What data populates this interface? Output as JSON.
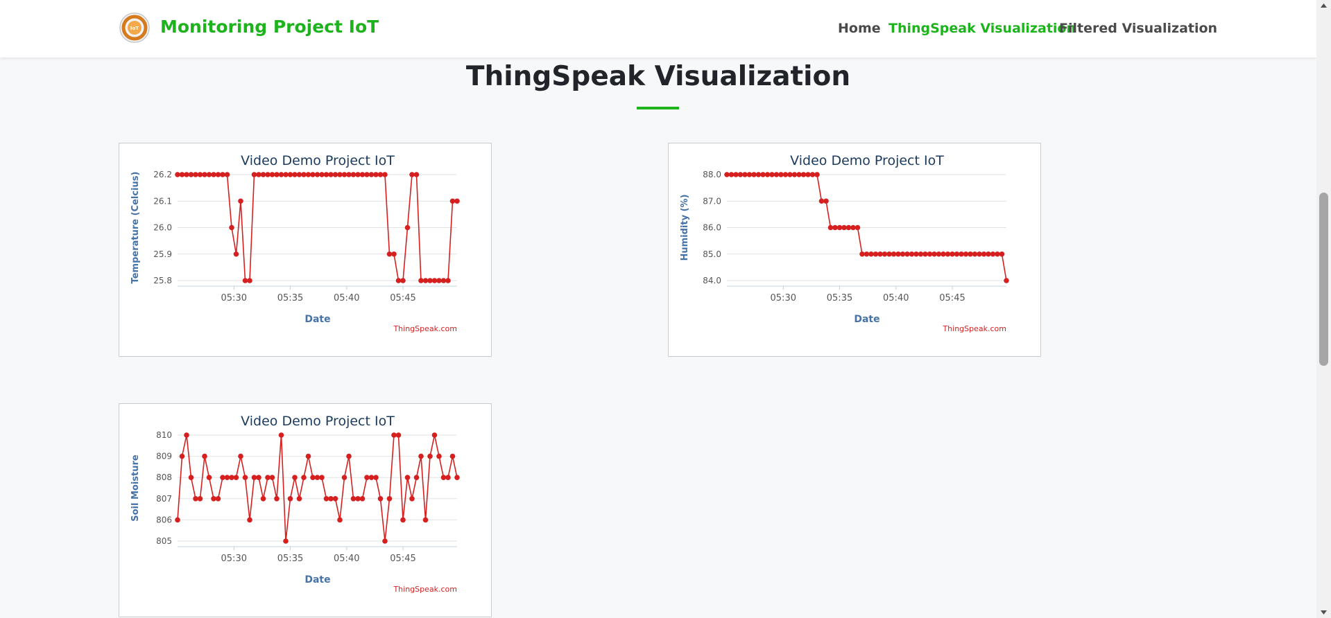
{
  "navbar": {
    "brand": "Monitoring Project IoT",
    "logo_text": "IoT",
    "links": [
      {
        "label": "Home",
        "active": false
      },
      {
        "label": "ThingSpeak Visualization",
        "active": true
      },
      {
        "label": "Filtered Visualization",
        "active": false
      }
    ]
  },
  "page": {
    "title": "ThingSpeak Visualization"
  },
  "colors": {
    "accent": "#1cb31c",
    "series": "#d62020",
    "chart_title": "#1b3a5c",
    "axis_label": "#4572a7"
  },
  "chart_data": [
    {
      "type": "line",
      "title": "Video Demo Project IoT",
      "xlabel": "Date",
      "ylabel": "Temperature (Celcius)",
      "credit": "ThingSpeak.com",
      "ylim": [
        25.8,
        26.2
      ],
      "yticks": [
        "26.2",
        "26.1",
        "26.0",
        "25.9",
        "25.8"
      ],
      "xticks": [
        "05:30",
        "05:35",
        "05:40",
        "05:45"
      ],
      "x_tick_minutes": [
        30,
        35,
        40,
        45
      ],
      "x": [
        "05:25",
        "05:25.5",
        "05:26",
        "05:26.5",
        "05:27",
        "05:27.5",
        "05:28",
        "05:28.5",
        "05:29",
        "05:29.5",
        "05:30",
        "05:30.5",
        "05:31",
        "05:31.5",
        "05:32",
        "05:32.5",
        "05:33",
        "05:33.5",
        "05:34",
        "05:34.5",
        "05:35",
        "05:35.5",
        "05:36",
        "05:36.5",
        "05:37",
        "05:37.5",
        "05:38",
        "05:38.5",
        "05:39",
        "05:39.5",
        "05:40",
        "05:40.5",
        "05:41",
        "05:41.5",
        "05:42",
        "05:42.5",
        "05:43",
        "05:43.5",
        "05:44",
        "05:44.5",
        "05:45",
        "05:45.5",
        "05:46",
        "05:46.5",
        "05:47",
        "05:47.5",
        "05:48",
        "05:48.5",
        "05:49",
        "05:49.5",
        "05:50"
      ],
      "x_minutes": [
        25,
        25.4,
        25.8,
        26.2,
        26.6,
        27,
        27.4,
        27.8,
        28.2,
        28.6,
        29,
        29.4,
        29.8,
        30.2,
        30.6,
        31,
        31.4,
        31.8,
        32.2,
        32.6,
        33,
        33.4,
        33.8,
        34.2,
        34.6,
        35,
        35.4,
        35.8,
        36.2,
        36.6,
        37,
        37.4,
        37.8,
        38.2,
        38.6,
        39,
        39.4,
        39.8,
        40.2,
        40.6,
        41,
        41.4,
        41.8,
        42.2,
        42.6,
        43,
        43.4,
        43.8,
        44.2,
        44.6,
        45,
        45.4,
        45.8,
        46.2,
        46.6,
        47,
        47.4,
        47.8,
        48.2,
        48.6,
        49,
        49.4,
        49.8
      ],
      "values": [
        26.2,
        26.2,
        26.2,
        26.2,
        26.2,
        26.2,
        26.2,
        26.2,
        26.2,
        26.2,
        26.2,
        26.2,
        26.0,
        25.9,
        26.1,
        25.8,
        25.8,
        26.2,
        26.2,
        26.2,
        26.2,
        26.2,
        26.2,
        26.2,
        26.2,
        26.2,
        26.2,
        26.2,
        26.2,
        26.2,
        26.2,
        26.2,
        26.2,
        26.2,
        26.2,
        26.2,
        26.2,
        26.2,
        26.2,
        26.2,
        26.2,
        26.2,
        26.2,
        26.2,
        26.2,
        26.2,
        26.2,
        25.9,
        25.9,
        25.8,
        25.8,
        26.0,
        26.2,
        26.2,
        25.8,
        25.8,
        25.8,
        25.8,
        25.8,
        25.8,
        25.8,
        26.1,
        26.1
      ]
    },
    {
      "type": "line",
      "title": "Video Demo Project IoT",
      "xlabel": "Date",
      "ylabel": "Humidity (%)",
      "credit": "ThingSpeak.com",
      "ylim": [
        84,
        88
      ],
      "yticks": [
        "88.0",
        "87.0",
        "86.0",
        "85.0",
        "84.0"
      ],
      "xticks": [
        "05:30",
        "05:35",
        "05:40",
        "05:45"
      ],
      "x_tick_minutes": [
        30,
        35,
        40,
        45
      ],
      "x_minutes": [
        25,
        25.4,
        25.8,
        26.2,
        26.6,
        27,
        27.4,
        27.8,
        28.2,
        28.6,
        29,
        29.4,
        29.8,
        30.2,
        30.6,
        31,
        31.4,
        31.8,
        32.2,
        32.6,
        33,
        33.4,
        33.8,
        34.2,
        34.6,
        35,
        35.4,
        35.8,
        36.2,
        36.6,
        37,
        37.4,
        37.8,
        38.2,
        38.6,
        39,
        39.4,
        39.8,
        40.2,
        40.6,
        41,
        41.4,
        41.8,
        42.2,
        42.6,
        43,
        43.4,
        43.8,
        44.2,
        44.6,
        45,
        45.4,
        45.8,
        46.2,
        46.6,
        47,
        47.4,
        47.8,
        48.2,
        48.6,
        49,
        49.4,
        49.8
      ],
      "values": [
        88,
        88,
        88,
        88,
        88,
        88,
        88,
        88,
        88,
        88,
        88,
        88,
        88,
        88,
        88,
        88,
        88,
        88,
        88,
        88,
        88,
        87,
        87,
        86,
        86,
        86,
        86,
        86,
        86,
        86,
        85,
        85,
        85,
        85,
        85,
        85,
        85,
        85,
        85,
        85,
        85,
        85,
        85,
        85,
        85,
        85,
        85,
        85,
        85,
        85,
        85,
        85,
        85,
        85,
        85,
        85,
        85,
        85,
        85,
        85,
        85,
        85,
        84
      ]
    },
    {
      "type": "line",
      "title": "Video Demo Project IoT",
      "xlabel": "Date",
      "ylabel": "Soil Moisture",
      "credit": "ThingSpeak.com",
      "ylim": [
        805,
        810
      ],
      "yticks": [
        "810",
        "809",
        "808",
        "807",
        "806",
        "805"
      ],
      "xticks": [
        "05:30",
        "05:35",
        "05:40",
        "05:45"
      ],
      "x_tick_minutes": [
        30,
        35,
        40,
        45
      ],
      "x_minutes": [
        25,
        25.4,
        25.8,
        26.2,
        26.6,
        27,
        27.4,
        27.8,
        28.2,
        28.6,
        29,
        29.4,
        29.8,
        30.2,
        30.6,
        31,
        31.4,
        31.8,
        32.2,
        32.6,
        33,
        33.4,
        33.8,
        34.2,
        34.6,
        35,
        35.4,
        35.8,
        36.2,
        36.6,
        37,
        37.4,
        37.8,
        38.2,
        38.6,
        39,
        39.4,
        39.8,
        40.2,
        40.6,
        41,
        41.4,
        41.8,
        42.2,
        42.6,
        43,
        43.4,
        43.8,
        44.2,
        44.6,
        45,
        45.4,
        45.8,
        46.2,
        46.6,
        47,
        47.4,
        47.8,
        48.2,
        48.6,
        49,
        49.4,
        49.8
      ],
      "values": [
        806,
        809,
        810,
        808,
        807,
        807,
        809,
        808,
        807,
        807,
        808,
        808,
        808,
        808,
        809,
        808,
        806,
        808,
        808,
        807,
        808,
        808,
        807,
        810,
        805,
        807,
        808,
        807,
        808,
        809,
        808,
        808,
        808,
        807,
        807,
        807,
        806,
        808,
        809,
        807,
        807,
        807,
        808,
        808,
        808,
        807,
        805,
        807,
        810,
        810,
        806,
        808,
        807,
        808,
        809,
        806,
        809,
        810,
        809,
        808,
        808,
        809,
        808
      ]
    }
  ]
}
